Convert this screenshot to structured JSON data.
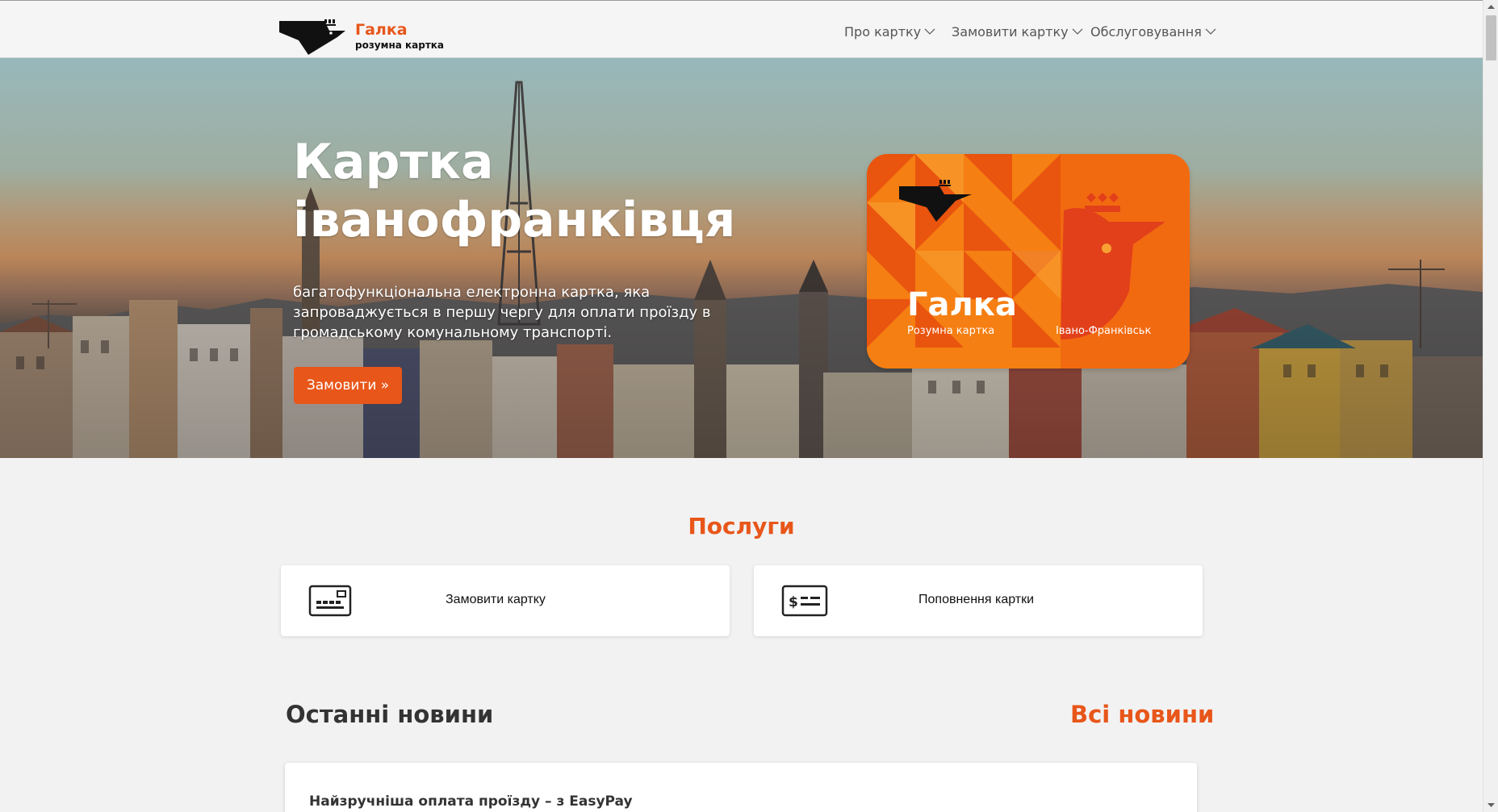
{
  "header": {
    "logo_title": "Галка",
    "logo_subtitle": "розумна картка",
    "nav": [
      {
        "label": "Про картку"
      },
      {
        "label": "Замовити картку"
      },
      {
        "label": "Обслуговування"
      }
    ]
  },
  "hero": {
    "title_line1": "Картка",
    "title_line2": "іванофранківця",
    "description": "багатофункціональна електронна картка, яка запроваджується в першу чергу для оплати проїзду в громадському комунальному транспорті.",
    "cta_label": "Замовити »",
    "card": {
      "title": "Галка",
      "subtitle": "Розумна картка",
      "city": "Івано-Франківськ"
    }
  },
  "services": {
    "title": "Послуги",
    "items": [
      {
        "label": "Замовити картку",
        "icon": "card-icon"
      },
      {
        "label": "Поповнення картки",
        "icon": "dollar-card-icon"
      }
    ]
  },
  "news": {
    "title": "Останні новини",
    "all_label": "Всі новини",
    "items": [
      {
        "title": "Найзручніша оплата проїзду – з EasyPay"
      }
    ]
  },
  "colors": {
    "accent": "#e8561a",
    "card_orange": "#f07a14",
    "text_dark": "#333333"
  }
}
